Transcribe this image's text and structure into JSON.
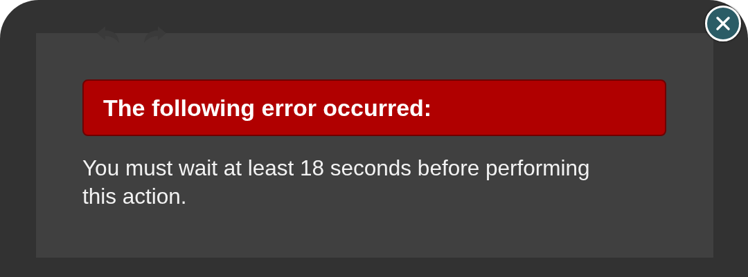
{
  "error_dialog": {
    "title": "The following error occurred:",
    "message": "You must wait at least 18 seconds before performing this action."
  }
}
